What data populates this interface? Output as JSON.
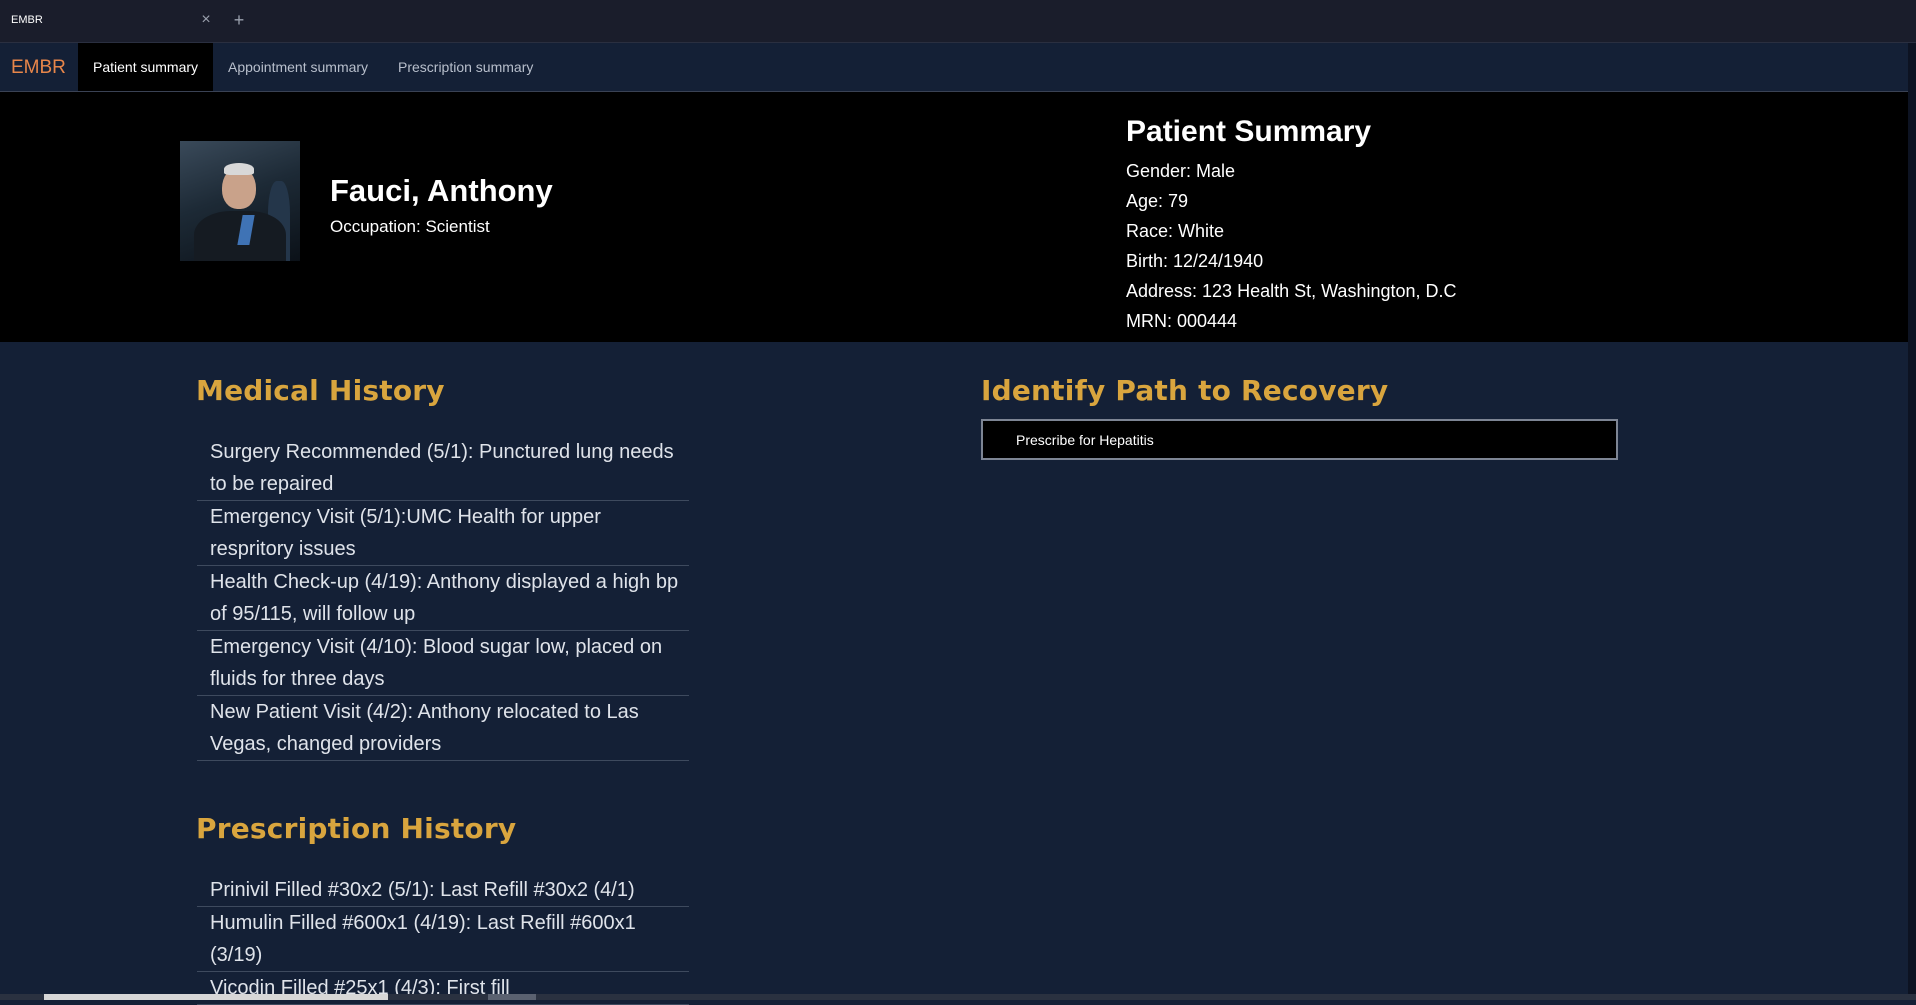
{
  "browser": {
    "tab_title": "EMBR",
    "close_glyph": "×",
    "new_tab_glyph": "+"
  },
  "navbar": {
    "brand": "EMBR",
    "tabs": [
      {
        "label": "Patient summary",
        "active": true
      },
      {
        "label": "Appointment summary",
        "active": false
      },
      {
        "label": "Prescription summary",
        "active": false
      }
    ]
  },
  "patient": {
    "name": "Fauci, Anthony",
    "occupation": "Occupation: Scientist",
    "summary_title": "Patient Summary",
    "details": [
      "Gender: Male",
      "Age: 79",
      "Race: White",
      "Birth: 12/24/1940",
      "Address: 123 Health St, Washington, D.C",
      "MRN: 000444"
    ]
  },
  "medical_history": {
    "title": "Medical History",
    "items": [
      "Surgery Recommended (5/1): Punctured lung needs to be repaired",
      "Emergency Visit (5/1):UMC Health for upper respritory issues",
      "Health Check-up (4/19): Anthony displayed a high bp of 95/115, will follow up",
      "Emergency Visit (4/10): Blood sugar low, placed on fluids for three days",
      "New Patient Visit (4/2): Anthony relocated to Las Vegas, changed providers"
    ]
  },
  "prescription_history": {
    "title": "Prescription History",
    "items": [
      "Prinivil Filled #30x2 (5/1): Last Refill #30x2 (4/1)",
      "Humulin Filled #600x1 (4/19): Last Refill #600x1 (3/19)",
      "Vicodin Filled #25x1 (4/3): First fill"
    ]
  },
  "recovery": {
    "title": "Identify Path to Recovery",
    "items": [
      "Prescribe for Hepatitis"
    ]
  },
  "colors": {
    "background": "#142036",
    "header": "#000000",
    "accent_gold": "#d9a53e",
    "brand_orange": "#e8864a"
  }
}
